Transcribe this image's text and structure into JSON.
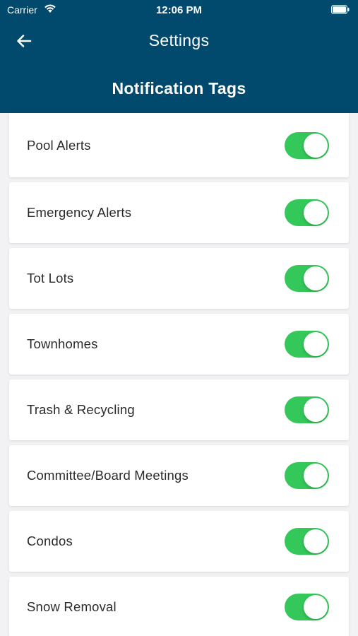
{
  "status_bar": {
    "carrier": "Carrier",
    "time": "12:06 PM"
  },
  "header": {
    "title": "Settings",
    "back_icon": "arrow-left-icon",
    "section_title": "Notification Tags",
    "background_color": "#02496e"
  },
  "toggle_color": "#34c759",
  "tags": [
    {
      "label": "Pool Alerts",
      "enabled": true
    },
    {
      "label": "Emergency Alerts",
      "enabled": true
    },
    {
      "label": "Tot Lots",
      "enabled": true
    },
    {
      "label": "Townhomes",
      "enabled": true
    },
    {
      "label": "Trash & Recycling",
      "enabled": true
    },
    {
      "label": "Committee/Board Meetings",
      "enabled": true
    },
    {
      "label": "Condos",
      "enabled": true
    },
    {
      "label": "Snow Removal",
      "enabled": true
    }
  ]
}
